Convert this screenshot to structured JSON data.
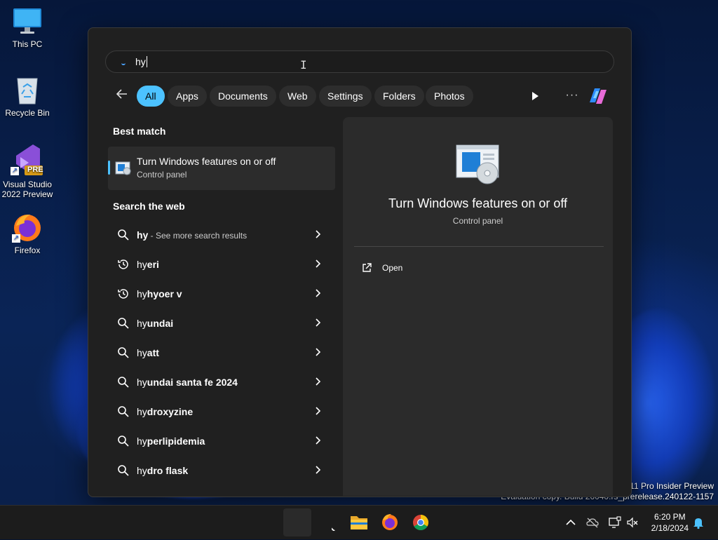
{
  "desktop": {
    "icons": [
      {
        "label": "This PC"
      },
      {
        "label": "Recycle Bin"
      },
      {
        "label": "Visual Studio 2022 Preview",
        "badge": "PRE"
      },
      {
        "label": "Firefox"
      }
    ],
    "watermark": {
      "line1": "s 11 Pro Insider Preview",
      "line2": "Evaluation copy. Build 26040.rs_prerelease.240122-1157"
    }
  },
  "search": {
    "query": "hy",
    "filters": [
      "All",
      "Apps",
      "Documents",
      "Web",
      "Settings",
      "Folders",
      "Photos"
    ],
    "active_filter": "All",
    "more_label": "···"
  },
  "best_match": {
    "heading": "Best match",
    "title": "Turn Windows features on or off",
    "subtitle": "Control panel",
    "icon": "windows-features-icon"
  },
  "web": {
    "heading": "Search the web",
    "results": [
      {
        "prefix": "hy",
        "bold": "",
        "suffix": " - See more search results",
        "icon": "search-icon"
      },
      {
        "prefix": "hy",
        "bold": "eri",
        "suffix": "",
        "icon": "history-icon"
      },
      {
        "prefix": "hy",
        "bold": "hyoer v",
        "suffix": "",
        "icon": "history-icon"
      },
      {
        "prefix": "hy",
        "bold": "undai",
        "suffix": "",
        "icon": "search-icon"
      },
      {
        "prefix": "hy",
        "bold": "att",
        "suffix": "",
        "icon": "search-icon"
      },
      {
        "prefix": "hy",
        "bold": "undai santa fe 2024",
        "suffix": "",
        "icon": "search-icon"
      },
      {
        "prefix": "hy",
        "bold": "droxyzine",
        "suffix": "",
        "icon": "search-icon"
      },
      {
        "prefix": "hy",
        "bold": "perlipidemia",
        "suffix": "",
        "icon": "search-icon"
      },
      {
        "prefix": "hy",
        "bold": "dro flask",
        "suffix": "",
        "icon": "search-icon"
      }
    ]
  },
  "detail": {
    "title": "Turn Windows features on or off",
    "subtitle": "Control panel",
    "action_open": "Open"
  },
  "taskbar": {
    "time": "6:20 PM",
    "date": "2/18/2024"
  },
  "colors": {
    "accent": "#4cc2ff",
    "panel_bg": "#202020",
    "detail_bg": "#2b2b2b"
  }
}
